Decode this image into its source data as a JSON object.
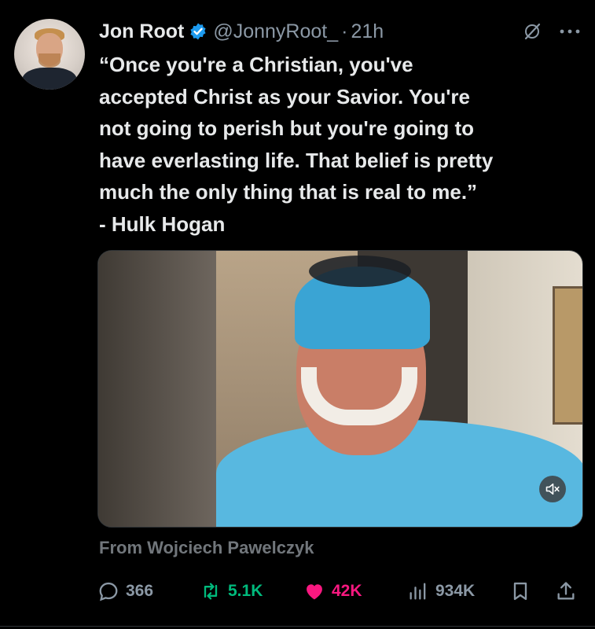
{
  "tweet": {
    "author_name": "Jon Root",
    "handle": "@JonnyRoot_",
    "separator": "·",
    "time": "21h",
    "text": "“Once you're a Christian, you've\naccepted Christ as your Savior. You're\nnot going to perish but you're going to\nhave everlasting life. That belief is pretty\nmuch the only thing that is real to me.”\n- Hulk Hogan",
    "attribution": "From Wojciech Pawelczyk"
  },
  "actions": {
    "replies": "366",
    "reposts": "5.1K",
    "likes": "42K",
    "views": "934K"
  },
  "icons": {
    "verified": "verified-badge-icon",
    "grok": "grok-icon",
    "more": "more-icon",
    "mute": "muted-speaker-icon",
    "reply": "reply-icon",
    "repost": "repost-icon",
    "like": "heart-icon",
    "views": "views-icon",
    "bookmark": "bookmark-icon",
    "share": "share-icon"
  },
  "colors": {
    "background": "#000000",
    "text": "#e7e9ea",
    "muted": "#8b98a5",
    "verified": "#1d9bf0",
    "repost": "#00ba7c",
    "like": "#f91880"
  }
}
